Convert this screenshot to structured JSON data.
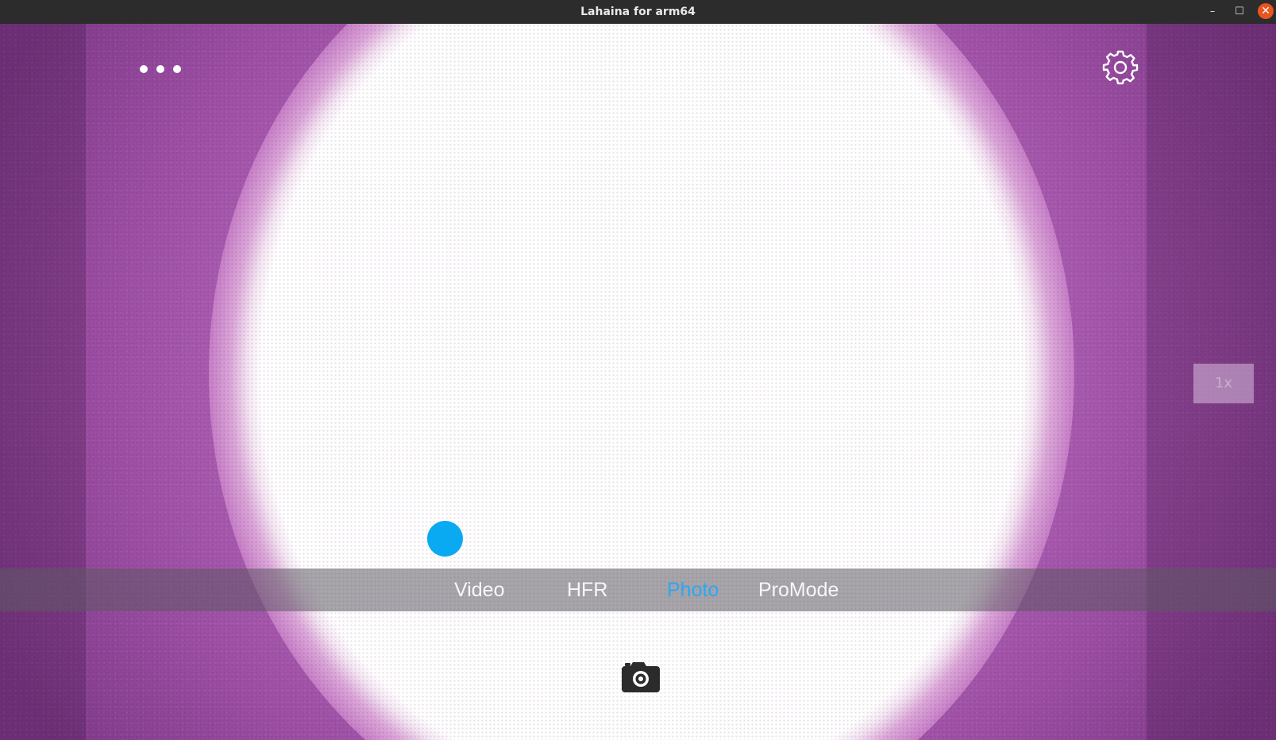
{
  "window": {
    "title": "Lahaina for arm64",
    "controls": {
      "minimize": "–",
      "maximize": "☐",
      "close": "✕"
    }
  },
  "camera": {
    "zoom_label": "1x",
    "modes": [
      {
        "label": "Video",
        "selected": false
      },
      {
        "label": "HFR",
        "selected": false
      },
      {
        "label": "Photo",
        "selected": true
      },
      {
        "label": "ProMode",
        "selected": false
      }
    ],
    "icons": {
      "more": "more-options-icon",
      "settings": "gear-icon",
      "shutter": "camera-icon"
    },
    "colors": {
      "accent": "#2aa8f0",
      "focus_indicator": "#0aaaf2",
      "close_button": "#e9541f"
    }
  }
}
